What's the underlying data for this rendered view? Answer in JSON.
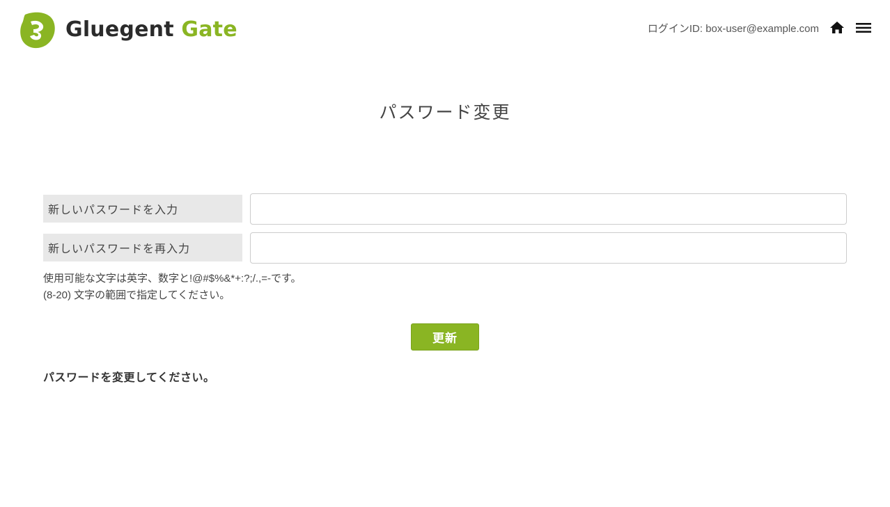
{
  "header": {
    "brand_part1": "Gluegent",
    "brand_part2": "Gate",
    "login_id_label": "ログインID: box-user@example.com",
    "home_icon": "home-icon",
    "menu_icon": "hamburger-menu-icon"
  },
  "page": {
    "title": "パスワード変更"
  },
  "form": {
    "new_password_label": "新しいパスワードを入力",
    "new_password_value": "",
    "confirm_password_label": "新しいパスワードを再入力",
    "confirm_password_value": "",
    "note_line1": "使用可能な文字は英字、数字と!@#$%&*+:?;/.,=-です。",
    "note_line2": "(8-20) 文字の範囲で指定してください。",
    "submit_label": "更新"
  },
  "message": "パスワードを変更してください。",
  "colors": {
    "accent": "#8ab523",
    "label_bg": "#e8e8e8"
  }
}
